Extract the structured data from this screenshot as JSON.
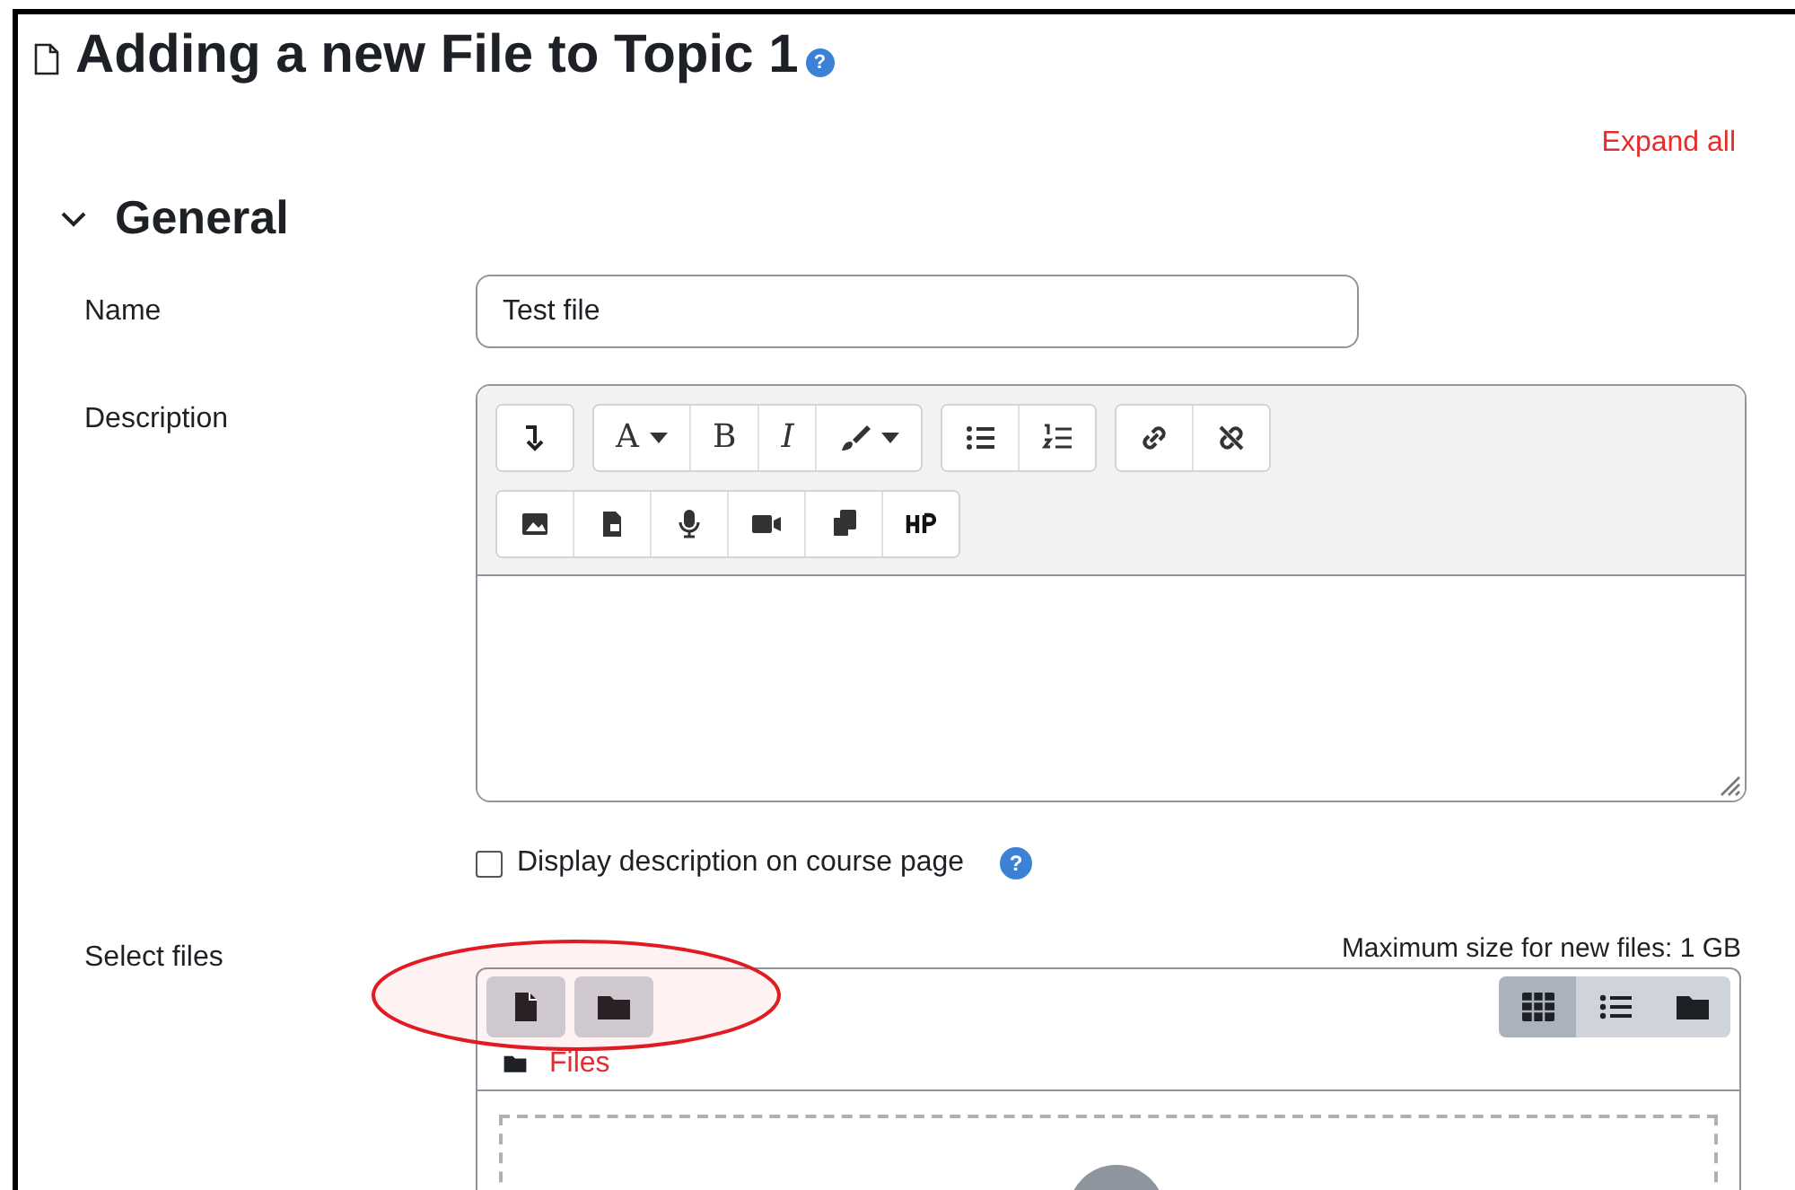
{
  "page": {
    "title": "Adding a new File to Topic 1",
    "help": "?",
    "expand_all": "Expand all"
  },
  "section": {
    "title": "General",
    "expanded": true
  },
  "fields": [
    {
      "kind": "text",
      "label": "Name",
      "value": "Test file"
    },
    {
      "kind": "editor",
      "label": "Description",
      "toolbar": [
        [
          {
            "kind": "collapse"
          }
        ],
        [
          {
            "kind": "glyphmenu",
            "glyph": "A"
          },
          {
            "kind": "glyph",
            "glyph": "B"
          },
          {
            "kind": "glyphitalic",
            "glyph": "I"
          },
          {
            "kind": "brush"
          }
        ],
        [
          {
            "kind": "bullets"
          },
          {
            "kind": "numbers"
          }
        ],
        [
          {
            "kind": "link"
          },
          {
            "kind": "unlink"
          }
        ],
        [
          {
            "kind": "image"
          },
          {
            "kind": "media"
          },
          {
            "kind": "mic"
          },
          {
            "kind": "video"
          },
          {
            "kind": "copy"
          },
          {
            "kind": "h5p"
          }
        ]
      ]
    },
    {
      "kind": "checkbox",
      "label": "Display description on course page",
      "checked": false,
      "help": "?"
    },
    {
      "kind": "filepicker",
      "label": "Select files",
      "max_size": "Maximum size for new files: 1 GB",
      "breadcrumb": "Files",
      "views": [
        {
          "selected": true
        },
        {
          "selected": false
        },
        {
          "selected": false
        }
      ]
    }
  ],
  "annotation": {
    "kind": "ellipse"
  }
}
